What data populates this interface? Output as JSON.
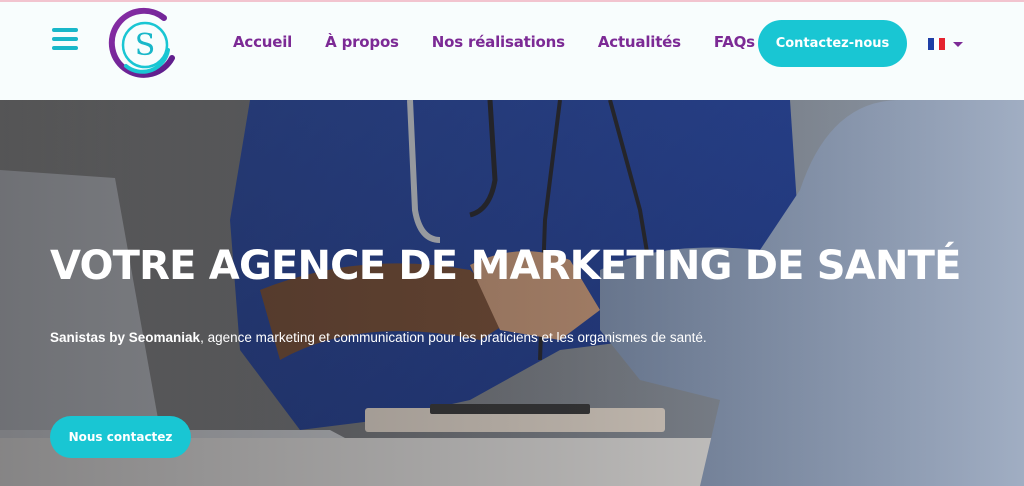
{
  "header": {
    "logo_letter": "S",
    "nav": [
      {
        "label": "Accueil"
      },
      {
        "label": "À propos"
      },
      {
        "label": "Nos réalisations"
      },
      {
        "label": "Actualités"
      },
      {
        "label": "FAQs"
      }
    ],
    "cta_label": "Contactez-nous",
    "language_flag_icon": "france-flag-icon"
  },
  "hero": {
    "title": "VOTRE AGENCE DE MARKETING DE SANTÉ",
    "subtitle_brand": "Sanistas by Seomaniak",
    "subtitle_rest": ", agence marketing et communication pour les praticiens et les organismes de santé.",
    "cta_label": "Nous contactez"
  },
  "colors": {
    "accent_cyan": "#19c6d3",
    "nav_purple": "#7c2a95",
    "header_bg": "#f8fdfd"
  }
}
